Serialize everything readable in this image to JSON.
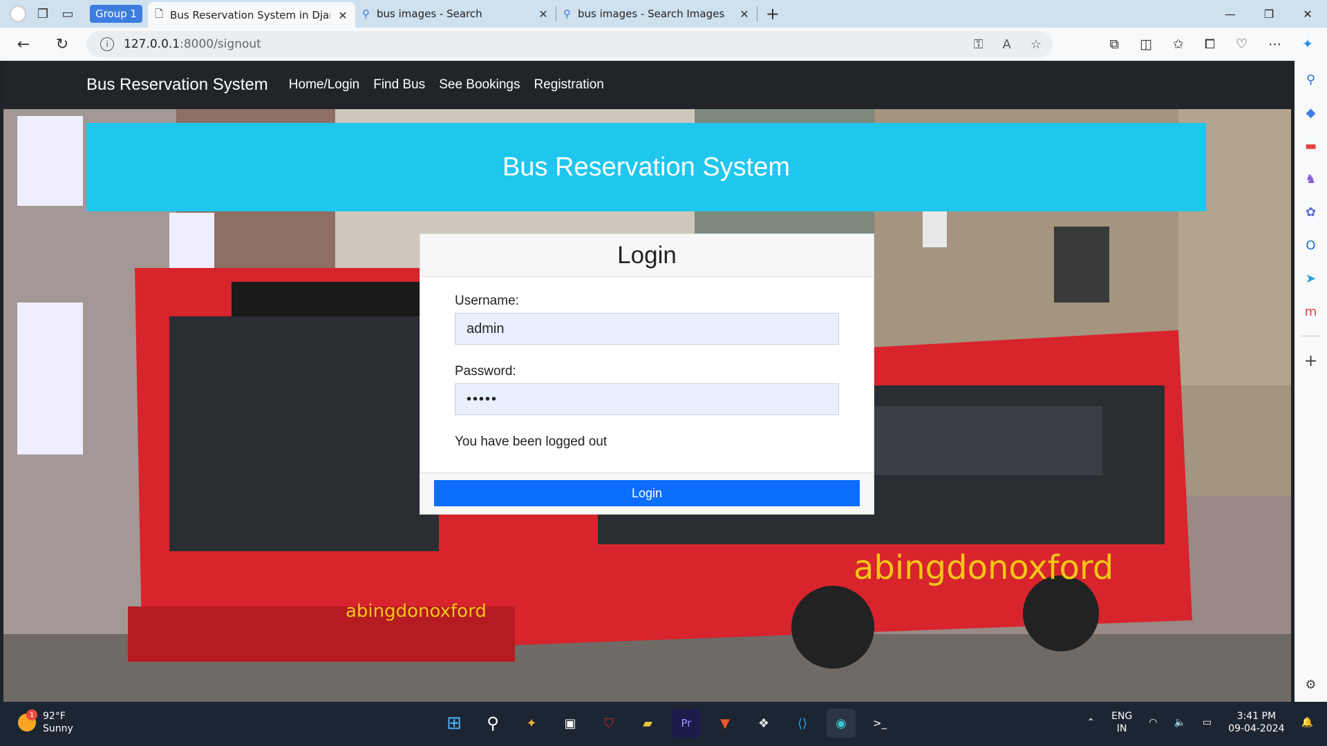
{
  "browser": {
    "tab_group": "Group 1",
    "tabs": [
      {
        "title": "Bus Reservation System in Djang"
      },
      {
        "title": "bus images - Search"
      },
      {
        "title": "bus images - Search Images"
      }
    ],
    "url_host": "127.0.0.1",
    "url_path": ":8000/signout"
  },
  "site": {
    "brand": "Bus Reservation System",
    "nav": [
      "Home/Login",
      "Find Bus",
      "See Bookings",
      "Registration"
    ],
    "hero_title": "Bus Reservation System"
  },
  "login": {
    "title": "Login",
    "username_label": "Username:",
    "username_value": "admin",
    "password_label": "Password:",
    "password_value": "•••••",
    "message": "You have been logged out",
    "button": "Login"
  },
  "taskbar": {
    "temperature": "92°F",
    "condition": "Sunny",
    "notification_count": "1",
    "lang_top": "ENG",
    "lang_bottom": "IN",
    "time": "3:41 PM",
    "date": "09-04-2024"
  },
  "colors": {
    "hero": "#1fc7ee",
    "button": "#0d6efd",
    "navbar": "#212529"
  }
}
